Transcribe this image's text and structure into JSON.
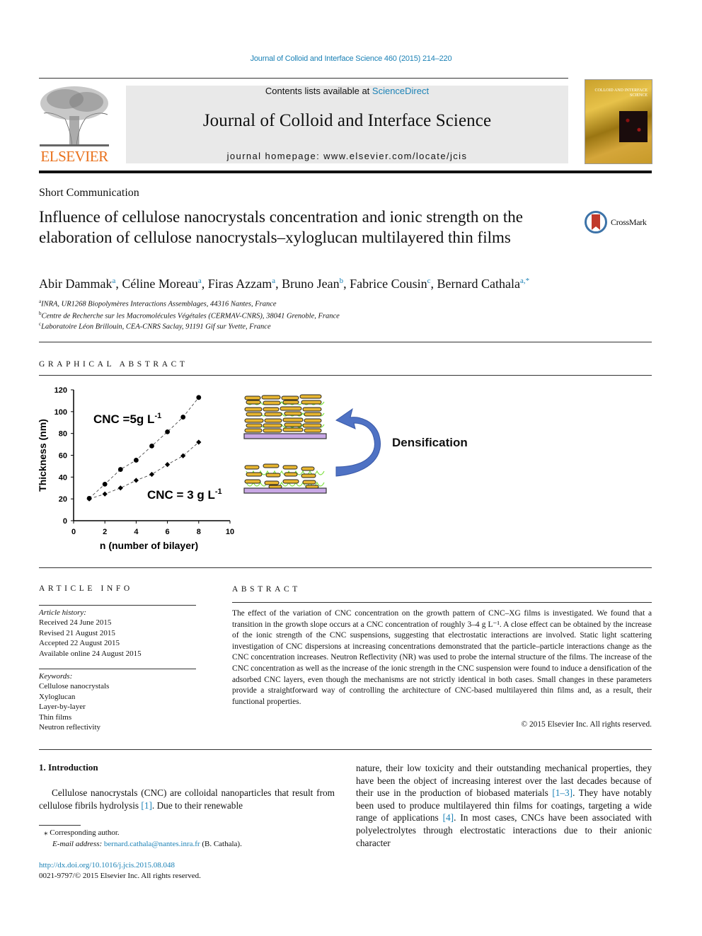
{
  "journal_ref": "Journal of Colloid and Interface Science 460 (2015) 214–220",
  "masthead": {
    "contents_prefix": "Contents lists available at ",
    "contents_link": "ScienceDirect",
    "journal_title": "Journal of Colloid and Interface Science",
    "homepage": "journal homepage: www.elsevier.com/locate/jcis",
    "publisher_logo": "ELSEVIER",
    "cover_title": "COLLOID AND INTERFACE SCIENCE"
  },
  "article": {
    "type": "Short Communication",
    "title": "Influence of cellulose nanocrystals concentration and ionic strength on the elaboration of cellulose nanocrystals–xyloglucan multilayered thin films",
    "crossmark": "CrossMark",
    "authors": [
      {
        "name": "Abir Dammak",
        "sup": "a"
      },
      {
        "name": "Céline Moreau",
        "sup": "a"
      },
      {
        "name": "Firas Azzam",
        "sup": "a"
      },
      {
        "name": "Bruno Jean",
        "sup": "b"
      },
      {
        "name": "Fabrice Cousin",
        "sup": "c"
      },
      {
        "name": "Bernard Cathala",
        "sup": "a,*"
      }
    ],
    "affiliations": [
      {
        "sup": "a",
        "text": "INRA, UR1268 Biopolymères Interactions Assemblages, 44316 Nantes, France"
      },
      {
        "sup": "b",
        "text": "Centre de Recherche sur les Macromolécules Végétales (CERMAV-CNRS), 38041 Grenoble, France"
      },
      {
        "sup": "c",
        "text": "Laboratoire Léon Brillouin, CEA-CNRS Saclay, 91191 Gif sur Yvette, France"
      }
    ]
  },
  "graphical_abstract": {
    "heading": "GRAPHICAL ABSTRACT",
    "densification_label": "Densification",
    "arrow_icon": "curved-arrow-icon"
  },
  "chart_data": {
    "type": "scatter",
    "title": "",
    "xlabel": "n (number of bilayer)",
    "ylabel": "Thickness (nm)",
    "xlim": [
      0,
      10
    ],
    "ylim": [
      0,
      120
    ],
    "xticks": [
      0,
      2,
      4,
      6,
      8,
      10
    ],
    "yticks": [
      0,
      20,
      40,
      60,
      80,
      100,
      120
    ],
    "grid": false,
    "series": [
      {
        "name": "CNC =5g L-1",
        "label_main": "CNC =5g L",
        "label_sup": "-1",
        "marker": "circle",
        "x": [
          1,
          2,
          3,
          4,
          5,
          6,
          7,
          8
        ],
        "y": [
          20.5,
          33.5,
          47,
          55.5,
          68.5,
          81.5,
          95,
          113
        ]
      },
      {
        "name": "CNC = 3 g L-1",
        "label_main": "CNC = 3 g L",
        "label_sup": "-1",
        "marker": "diamond",
        "x": [
          1,
          2,
          3,
          4,
          5,
          6,
          7,
          8
        ],
        "y": [
          20,
          24.5,
          30,
          37,
          42.5,
          51.5,
          59.5,
          72
        ]
      }
    ]
  },
  "article_info": {
    "heading": "ARTICLE INFO",
    "history_label": "Article history:",
    "history": [
      "Received 24 June 2015",
      "Revised 21 August 2015",
      "Accepted 22 August 2015",
      "Available online 24 August 2015"
    ],
    "keywords_label": "Keywords:",
    "keywords": [
      "Cellulose nanocrystals",
      "Xyloglucan",
      "Layer-by-layer",
      "Thin films",
      "Neutron reflectivity"
    ]
  },
  "abstract": {
    "heading": "ABSTRACT",
    "text": "The effect of the variation of CNC concentration on the growth pattern of CNC–XG films is investigated. We found that a transition in the growth slope occurs at a CNC concentration of roughly 3–4 g L⁻¹. A close effect can be obtained by the increase of the ionic strength of the CNC suspensions, suggesting that electrostatic interactions are involved. Static light scattering investigation of CNC dispersions at increasing concentrations demonstrated that the particle–particle interactions change as the CNC concentration increases. Neutron Reflectivity (NR) was used to probe the internal structure of the films. The increase of the CNC concentration as well as the increase of the ionic strength in the CNC suspension were found to induce a densification of the adsorbed CNC layers, even though the mechanisms are not strictly identical in both cases. Small changes in these parameters provide a straightforward way of controlling the architecture of CNC-based multilayered thin films and, as a result, their functional properties.",
    "copyright": "© 2015 Elsevier Inc. All rights reserved."
  },
  "introduction": {
    "heading": "1. Introduction",
    "left_p1": "Cellulose nanocrystals (CNC) are colloidal nanoparticles that result from cellulose fibrils hydrolysis ",
    "left_ref1": "[1]",
    "left_p2": ". Due to their renewable",
    "right_p1": "nature, their low toxicity and their outstanding mechanical properties, they have been the object of increasing interest over the last decades because of their use in the production of biobased materials ",
    "right_ref1": "[1–3]",
    "right_p2": ". They have notably been used to produce multilayered thin films for coatings, targeting a wide range of applications ",
    "right_ref2": "[4]",
    "right_p3": ". In most cases, CNCs have been associated with polyelectrolytes through electrostatic interactions due to their anionic character"
  },
  "footnotes": {
    "corresponding": "⁎ Corresponding author.",
    "email_label": "E-mail address: ",
    "email": "bernard.cathala@nantes.inra.fr",
    "email_suffix": " (B. Cathala).",
    "doi": "http://dx.doi.org/10.1016/j.jcis.2015.08.048",
    "issn": "0021-9797/© 2015 Elsevier Inc. All rights reserved."
  }
}
